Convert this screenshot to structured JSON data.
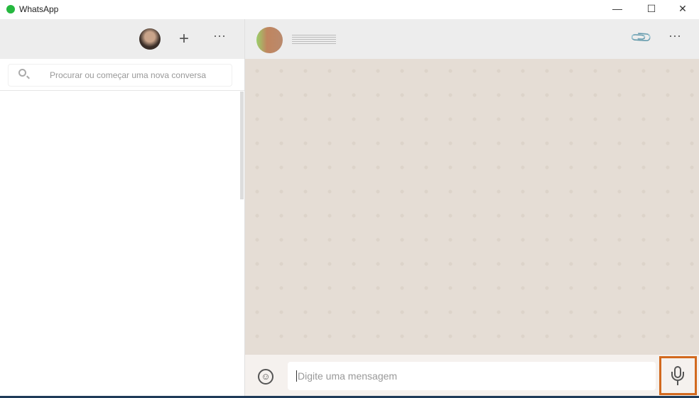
{
  "window": {
    "title": "WhatsApp",
    "minimize": "—",
    "maximize": "☐",
    "close": "✕"
  },
  "sidebar": {
    "new_chat": "+",
    "menu": "···",
    "search_placeholder": "Procurar ou começar uma nova conversa"
  },
  "chat": {
    "attach": "📎",
    "menu": "···",
    "input_placeholder": "Digite uma mensagem",
    "emoji": "☺"
  },
  "colors": {
    "accent": "#25b83f",
    "highlight": "#d2691e"
  }
}
